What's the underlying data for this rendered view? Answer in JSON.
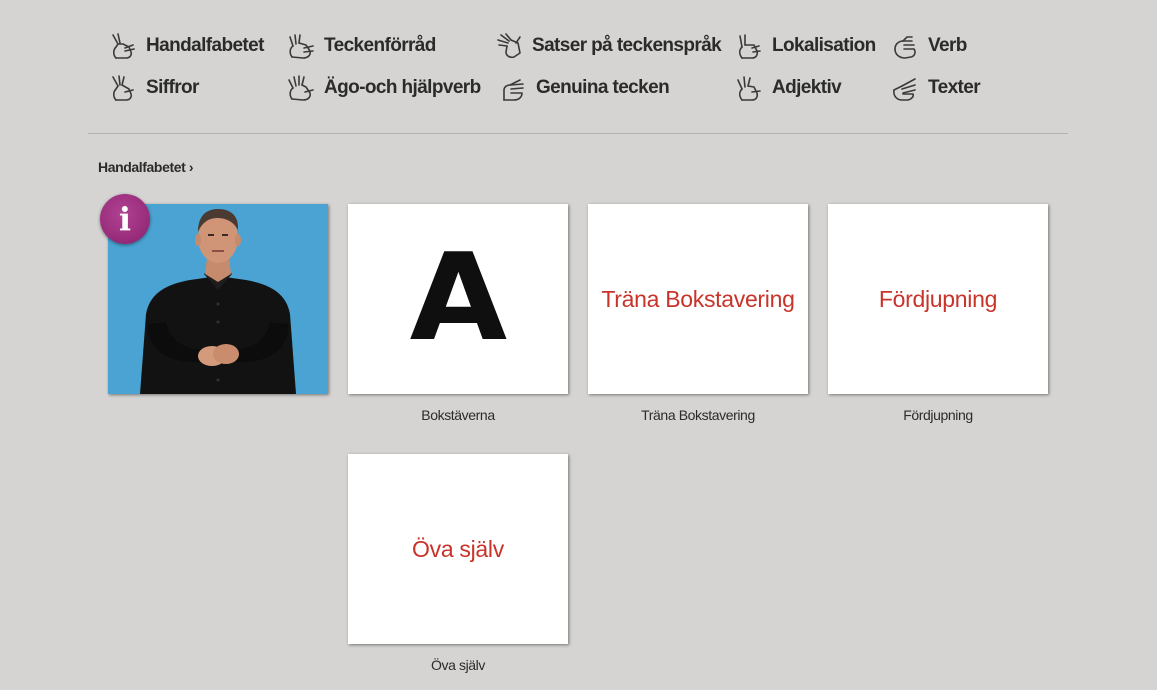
{
  "nav": {
    "items": [
      {
        "label": "Handalfabetet",
        "icon": "hand-sign-icon"
      },
      {
        "label": "Teckenförråd",
        "icon": "hand-sign-icon"
      },
      {
        "label": "Satser på teckenspråk",
        "icon": "hand-sign-icon"
      },
      {
        "label": "Lokalisation",
        "icon": "hand-sign-icon"
      },
      {
        "label": "Verb",
        "icon": "hand-sign-icon"
      },
      {
        "label": "Siffror",
        "icon": "hand-sign-icon"
      },
      {
        "label": "Ägo-och hjälpverb",
        "icon": "hand-sign-icon"
      },
      {
        "label": "Genuina tecken",
        "icon": "hand-sign-icon"
      },
      {
        "label": "Adjektiv",
        "icon": "hand-sign-icon"
      },
      {
        "label": "Texter",
        "icon": "hand-sign-icon"
      }
    ]
  },
  "breadcrumb": {
    "label": "Handalfabetet ›"
  },
  "info_badge": {
    "symbol": "i",
    "color": "#9a2e7d"
  },
  "tiles": [
    {
      "kind": "video",
      "caption": ""
    },
    {
      "kind": "letter",
      "content": "A",
      "caption": "Bokstäverna"
    },
    {
      "kind": "text",
      "content": "Träna Bokstavering",
      "caption": "Träna Bokstavering"
    },
    {
      "kind": "text",
      "content": "Fördjupning",
      "caption": "Fördjupning"
    },
    {
      "kind": "text",
      "content": "Öva själv",
      "caption": "Öva själv"
    }
  ],
  "colors": {
    "background": "#d5d4d2",
    "tile_text": "#c8332a",
    "video_background": "#4aa3d2"
  }
}
